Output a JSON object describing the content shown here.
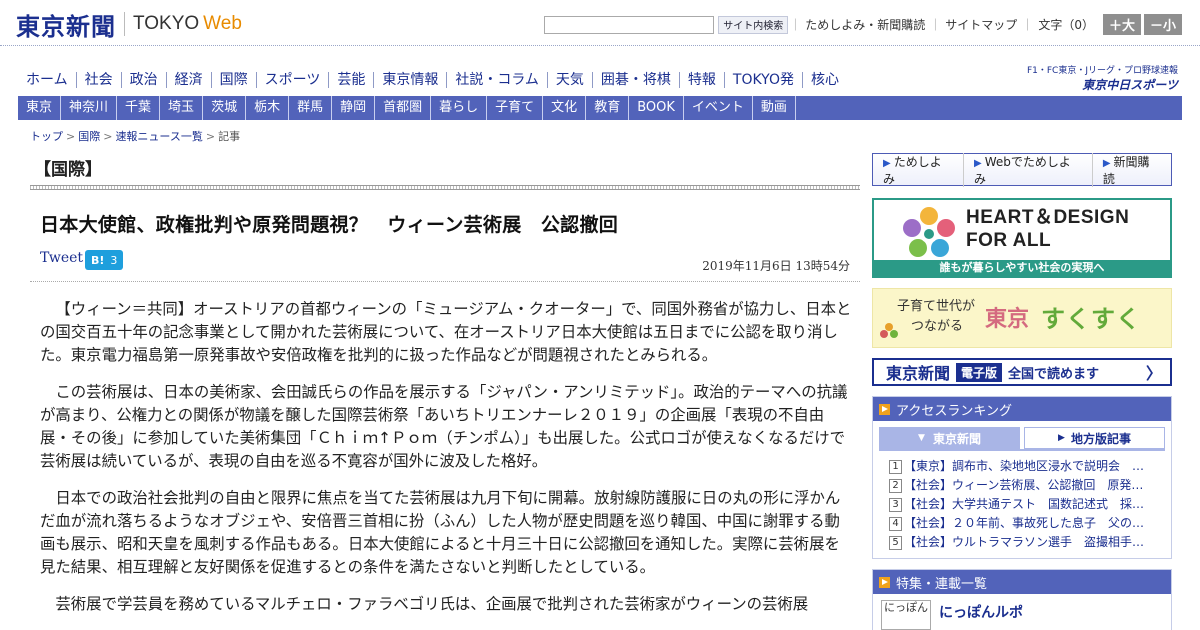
{
  "header": {
    "logo_kanji": "東京新聞",
    "logo_en": "TOKYO",
    "logo_web": "Web",
    "search_placeholder": "",
    "search_button": "サイト内検索",
    "links": [
      "ためしよみ・新聞購読",
      "サイトマップ"
    ],
    "fontsize_label": "文字（0）",
    "font_large": "＋大",
    "font_small": "－小"
  },
  "nav_main": [
    "ホーム",
    "社会",
    "政治",
    "経済",
    "国際",
    "スポーツ",
    "芸能",
    "東京情報",
    "社説・コラム",
    "天気",
    "囲碁・将棋",
    "特報",
    "TOKYO発",
    "核心"
  ],
  "side_logo": {
    "top": "F1・FC東京・Jリーグ・プロ野球速報",
    "main": "東京中日スポーツ"
  },
  "nav_region": [
    "東京",
    "神奈川",
    "千葉",
    "埼玉",
    "茨城",
    "栃木",
    "群馬",
    "静岡",
    "首都圏",
    "暮らし",
    "子育て",
    "文化",
    "教育",
    "BOOK",
    "イベント",
    "動画"
  ],
  "breadcrumb": [
    "トップ",
    "国際",
    "速報ニュース一覧",
    "記事"
  ],
  "article": {
    "section": "【国際】",
    "headline": "日本大使館、政権批判や原発問題視？　ウィーン芸術展　公認撤回",
    "tweet": "Tweet",
    "hatena_label": "B!",
    "hatena_count": "3",
    "date": "2019年11月6日 13時54分",
    "paragraphs": [
      "【ウィーン＝共同】オーストリアの首都ウィーンの「ミュージアム・クオーター」で、同国外務省が協力し、日本との国交百五十年の記念事業として開かれた芸術展について、在オーストリア日本大使館は五日までに公認を取り消した。東京電力福島第一原発事故や安倍政権を批判的に扱った作品などが問題視されたとみられる。",
      "この芸術展は、日本の美術家、会田誠氏らの作品を展示する「ジャパン・アンリミテッド」。政治的テーマへの抗議が高まり、公権力との関係が物議を醸した国際芸術祭「あいちトリエンナーレ２０１９」の企画展「表現の不自由展・その後」に参加していた美術集団「Ｃｈｉｍ↑Ｐｏｍ（チンポム）」も出展した。公式ロゴが使えなくなるだけで芸術展は続いているが、表現の自由を巡る不寛容が国外に波及した格好。",
      "日本での政治社会批判の自由と限界に焦点を当てた芸術展は九月下旬に開幕。放射線防護服に日の丸の形に浮かんだ血が流れ落ちるようなオブジェや、安倍晋三首相に扮（ふん）した人物が歴史問題を巡り韓国、中国に謝罪する動画も展示、昭和天皇を風刺する作品もある。日本大使館によると十月三十日に公認撤回を通知した。実際に芸術展を見た結果、相互理解と友好関係を促進するとの条件を満たさないと判断したとしている。",
      "芸術展で学芸員を務めているマルチェロ・ファラベゴリ氏は、企画展で批判された芸術家がウィーンの芸術展"
    ]
  },
  "sidebar": {
    "promo_tabs": [
      "ためしよみ",
      "Webでためしよみ",
      "新聞購読"
    ],
    "heart": {
      "title_line1": "HEART＆DESIGN",
      "title_line2": "FOR ALL",
      "caption": "誰もが暮らしやすい社会の実現へ"
    },
    "sukusuku": {
      "left_line1": "子育て世代が",
      "left_line2": "つながる",
      "tokyo": "東京",
      "main": "すくすく"
    },
    "denshi": {
      "logo": "東京新聞",
      "tag": "電子版",
      "text": "全国で読めます",
      "arrow": "〉"
    },
    "ranking": {
      "title": "アクセスランキング",
      "tab_tokyo": "東京新聞",
      "tab_local": "地方版記事",
      "items": [
        {
          "num": "1",
          "text": "【東京】調布市、染地地区浸水で説明会　…"
        },
        {
          "num": "2",
          "text": "【社会】ウィーン芸術展、公認撤回　原発…"
        },
        {
          "num": "3",
          "text": "【社会】大学共通テスト　国数記述式　採…"
        },
        {
          "num": "4",
          "text": "【社会】２０年前、事故死した息子　父の…"
        },
        {
          "num": "5",
          "text": "【社会】ウルトラマラソン選手　盗撮相手…"
        }
      ]
    },
    "features": {
      "title": "特集・連載一覧",
      "icon_text": "にっぽん",
      "item_title": "にっぽんルポ"
    }
  }
}
